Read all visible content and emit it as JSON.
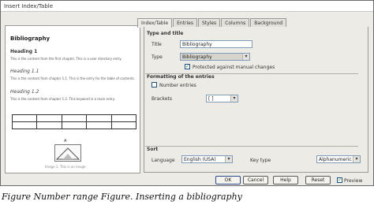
{
  "window": {
    "title": "Insert Index/Table"
  },
  "preview": {
    "heading": "Bibliography",
    "heading1": "Heading 1",
    "line1": "This is the content from the first chapter. This is a user directory entry.",
    "heading11": "Heading 1.1",
    "line2": "This is the content from chapter 1.1. This is the entry for the table of contents.",
    "heading12": "Heading 1.2",
    "line3": "This is the content from chapter 1.2. This keyword is a main entry.",
    "image_label": "A",
    "image_caption": "Image 1: This is an image"
  },
  "tabs": [
    "Index/Table",
    "Entries",
    "Styles",
    "Columns",
    "Background"
  ],
  "type_section": {
    "heading": "Type and title",
    "title_label": "Title",
    "title_value": "Bibliography",
    "type_label": "Type",
    "type_value": "Bibliography",
    "protect_label": "Protected against manual changes",
    "protect_checked": true
  },
  "formatting_section": {
    "heading": "Formatting of the entries",
    "number_entries_label": "Number entries",
    "number_entries_checked": false,
    "brackets_label": "Brackets",
    "brackets_value": "[ ]"
  },
  "sort_section": {
    "heading": "Sort",
    "language_label": "Language",
    "language_value": "English (USA)",
    "key_type_label": "Key type",
    "key_type_value": "Alphanumeric"
  },
  "buttons": {
    "ok": "OK",
    "cancel": "Cancel",
    "help": "Help",
    "reset": "Reset",
    "preview_label": "Preview",
    "preview_checked": true
  },
  "figure_caption": "Figure Number range Figure. Inserting a bibliography"
}
